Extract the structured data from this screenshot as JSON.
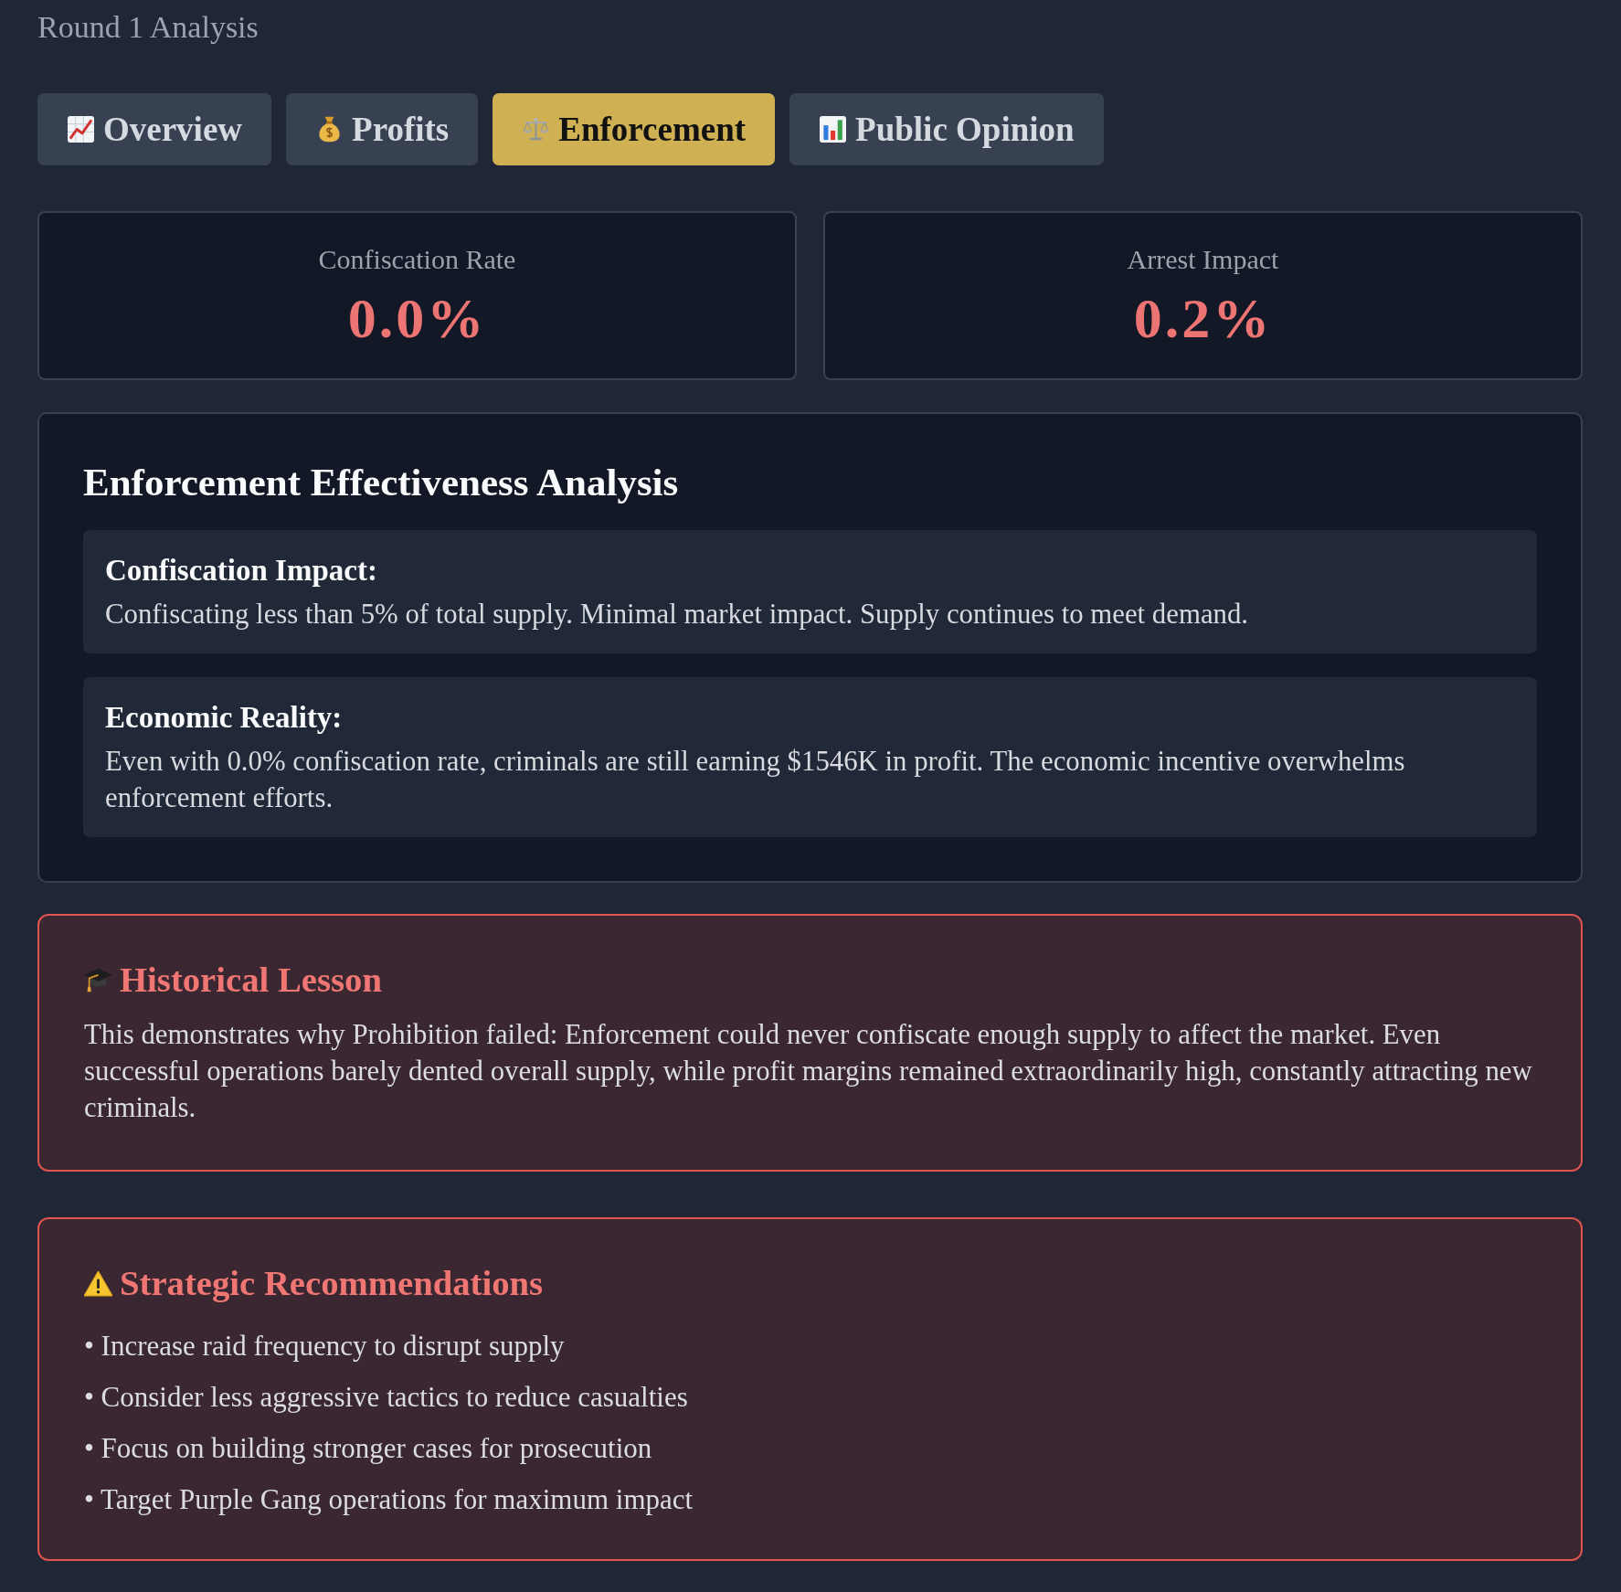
{
  "header": {
    "title": "Round 1 Analysis"
  },
  "tabs": [
    {
      "label": "Overview",
      "selected": false
    },
    {
      "label": "Profits",
      "selected": false
    },
    {
      "label": "Enforcement",
      "selected": true
    },
    {
      "label": "Public Opinion",
      "selected": false
    }
  ],
  "metrics": [
    {
      "label": "Confiscation Rate",
      "value": "0.0%"
    },
    {
      "label": "Arrest Impact",
      "value": "0.2%"
    }
  ],
  "analysis": {
    "title": "Enforcement Effectiveness Analysis",
    "items": [
      {
        "heading": "Confiscation Impact:",
        "text": "Confiscating less than 5% of total supply. Minimal market impact. Supply continues to meet demand."
      },
      {
        "heading": "Economic Reality:",
        "text": "Even with 0.0% confiscation rate, criminals are still earning $1546K in profit. The economic incentive overwhelms enforcement efforts."
      }
    ]
  },
  "historical_lesson": {
    "title": "Historical Lesson",
    "text": "This demonstrates why Prohibition failed: Enforcement could never confiscate enough supply to affect the market. Even successful operations barely dented overall supply, while profit margins remained extraordinarily high, constantly attracting new criminals."
  },
  "recommendations": {
    "title": "Strategic Recommendations",
    "items": [
      "• Increase raid frequency to disrupt supply",
      "• Consider less aggressive tactics to reduce casualties",
      "• Focus on building stronger cases for prosecution",
      "• Target Purple Gang operations for maximum impact"
    ]
  }
}
